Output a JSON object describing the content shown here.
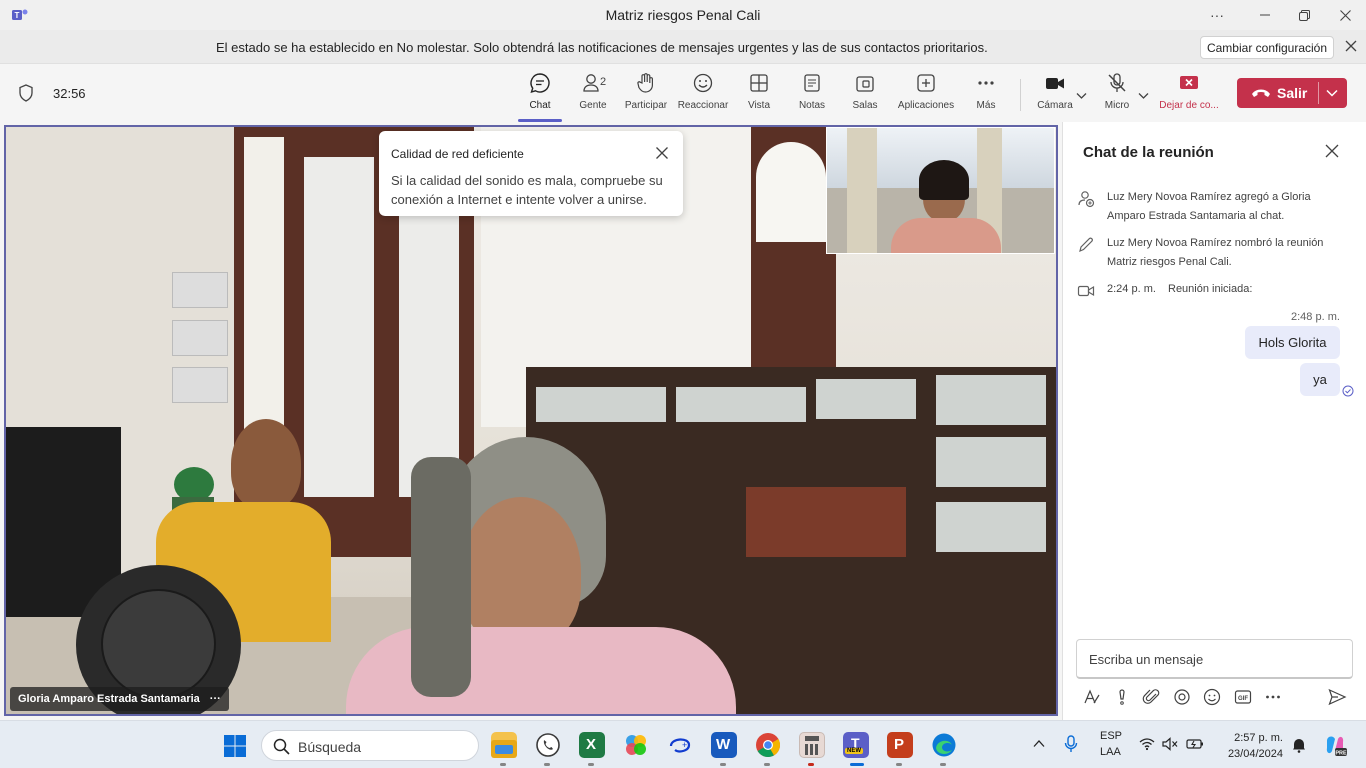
{
  "window": {
    "title": "Matriz riesgos Penal Cali",
    "controls": [
      "more-icon",
      "minimize-icon",
      "restore-icon",
      "close-icon"
    ]
  },
  "notice": {
    "message": "El estado se ha establecido en No molestar. Solo obtendrá las notificaciones de mensajes urgentes y las de sus contactos prioritarios.",
    "button": "Cambiar configuración"
  },
  "toolbar": {
    "timer": "32:56",
    "items": [
      {
        "label": "Chat",
        "icon": "chat-icon",
        "active": true
      },
      {
        "label": "Gente",
        "icon": "people-icon",
        "badge": "2"
      },
      {
        "label": "Participar",
        "icon": "raise-hand-icon"
      },
      {
        "label": "Reaccionar",
        "icon": "react-icon"
      },
      {
        "label": "Vista",
        "icon": "view-icon"
      },
      {
        "label": "Notas",
        "icon": "notes-icon"
      },
      {
        "label": "Salas",
        "icon": "rooms-icon"
      },
      {
        "label": "Aplicaciones",
        "icon": "apps-icon"
      },
      {
        "label": "Más",
        "icon": "more-icon"
      }
    ],
    "camera": "Cámara",
    "mic": "Micro",
    "share": "Dejar de co...",
    "leave": "Salir",
    "accent": "#5b5fc7",
    "leave_color": "#c4314b"
  },
  "stage": {
    "participant_name": "Gloria Amparo Estrada Santamaria",
    "toast": {
      "title": "Calidad de red deficiente",
      "body": "Si la calidad del sonido es mala, compruebe su conexión a Internet e intente volver a unirse."
    }
  },
  "chat": {
    "title": "Chat de la reunión",
    "events": [
      {
        "icon": "add-person-icon",
        "text": "Luz Mery Novoa Ramírez agregó a Gloria Amparo Estrada Santamaria al chat."
      },
      {
        "icon": "pencil-icon",
        "text": "Luz Mery Novoa Ramírez nombró la reunión Matriz riesgos Penal Cali."
      },
      {
        "icon": "video-icon",
        "time": "2:24 p. m.",
        "text": "Reunión iniciada:"
      }
    ],
    "timestamp": "2:48 p. m.",
    "messages": [
      "Hols Glorita",
      "ya"
    ],
    "composer_placeholder": "Escriba un mensaje",
    "composer_tools": [
      "format-icon",
      "priority-icon",
      "attach-icon",
      "loop-icon",
      "emoji-icon",
      "gif-icon",
      "more-icon",
      "send-icon"
    ]
  },
  "taskbar": {
    "search_placeholder": "Búsqueda",
    "apps": [
      "file-explorer-icon",
      "whatsapp-icon",
      "excel-icon",
      "photos-icon",
      "disney-icon",
      "word-icon",
      "chrome-icon",
      "calculator-icon",
      "teams-icon",
      "powerpoint-icon",
      "edge-icon"
    ],
    "lang_top": "ESP",
    "lang_bottom": "LAA",
    "time": "2:57 p. m.",
    "date": "23/04/2024"
  }
}
